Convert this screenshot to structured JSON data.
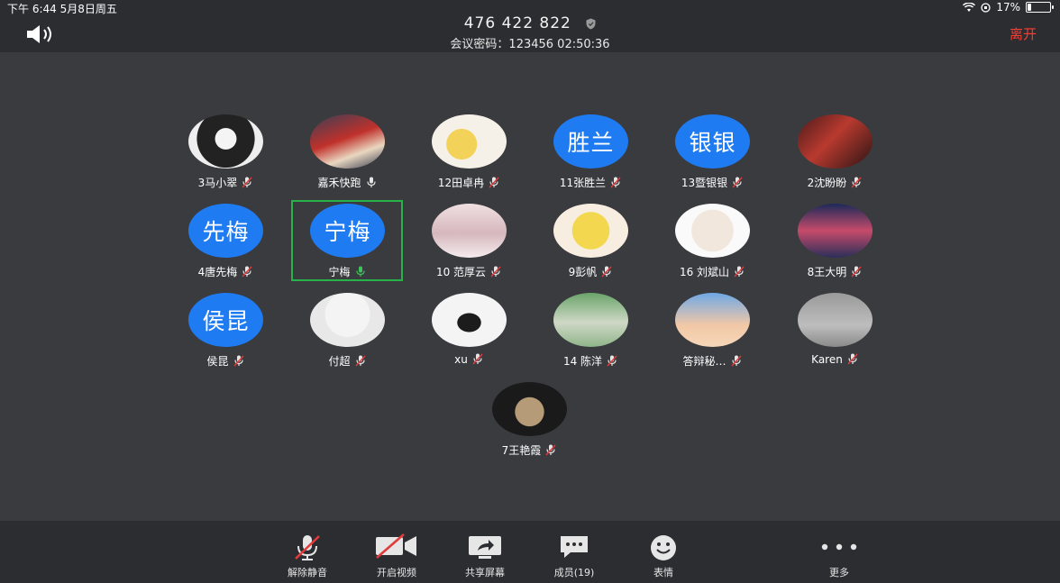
{
  "status": {
    "time": "下午 6:44   5月8日周五",
    "battery": "17%",
    "battery_level": 0.17
  },
  "header": {
    "meeting_id": "476 422 822",
    "sub": "会议密码：123456   02:50:36",
    "leave": "离开"
  },
  "colors": {
    "avatar_blue": "#1f7bf2",
    "active_green": "#27b24a",
    "leave_red": "#ff3b30"
  },
  "participants": [
    {
      "name": "3马小翠",
      "avatar_text": "",
      "mic": "muted"
    },
    {
      "name": "嘉禾快跑",
      "avatar_text": "",
      "mic": "on"
    },
    {
      "name": "12田卓冉",
      "avatar_text": "",
      "mic": "muted"
    },
    {
      "name": "11张胜兰",
      "avatar_text": "胜兰",
      "mic": "muted"
    },
    {
      "name": "13暨银银",
      "avatar_text": "银银",
      "mic": "muted"
    },
    {
      "name": "2沈盼盼",
      "avatar_text": "",
      "mic": "muted"
    },
    {
      "name": "4唐先梅",
      "avatar_text": "先梅",
      "mic": "muted"
    },
    {
      "name": "宁梅",
      "avatar_text": "宁梅",
      "mic": "speaking"
    },
    {
      "name": "10 范厚云",
      "avatar_text": "",
      "mic": "muted"
    },
    {
      "name": "9彭帆",
      "avatar_text": "",
      "mic": "muted"
    },
    {
      "name": "16 刘斌山",
      "avatar_text": "",
      "mic": "muted"
    },
    {
      "name": "8王大明",
      "avatar_text": "",
      "mic": "muted"
    },
    {
      "name": "侯昆",
      "avatar_text": "侯昆",
      "mic": "muted"
    },
    {
      "name": "付超",
      "avatar_text": "",
      "mic": "muted"
    },
    {
      "name": "xu",
      "avatar_text": "",
      "mic": "muted"
    },
    {
      "name": "14 陈洋",
      "avatar_text": "",
      "mic": "muted"
    },
    {
      "name": "答辩秘…",
      "avatar_text": "",
      "mic": "muted"
    },
    {
      "name": "Karen",
      "avatar_text": "",
      "mic": "muted"
    },
    {
      "name": "7王艳霞",
      "avatar_text": "",
      "mic": "muted"
    }
  ],
  "toolbar": {
    "unmute": "解除静音",
    "video": "开启视频",
    "share": "共享屏幕",
    "members": "成员(19)",
    "emoji": "表情",
    "more": "更多"
  }
}
